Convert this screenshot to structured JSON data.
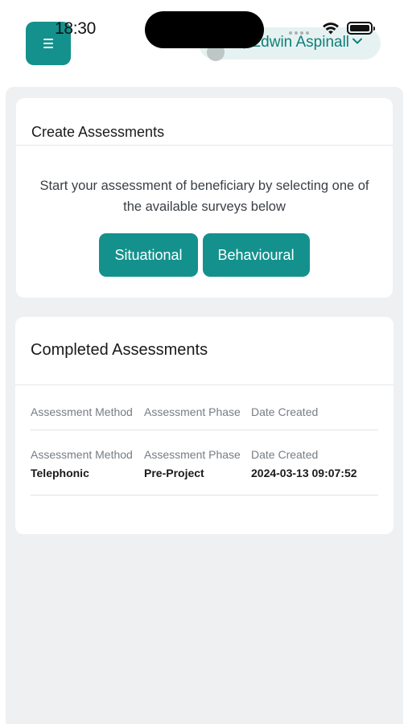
{
  "status_bar": {
    "time": "18:30"
  },
  "header": {
    "menu_label": "≡",
    "user_greeting": "Hi, Edwin Aspinall"
  },
  "create_assessments": {
    "title": "Create Assessments",
    "description": "Start your assessment of beneficiary by selecting one of the available surveys below",
    "buttons": [
      {
        "label": "Situational"
      },
      {
        "label": "Behavioural"
      }
    ]
  },
  "completed_assessments": {
    "title": "Completed Assessments",
    "columns": [
      "Assessment Method",
      "Assessment Phase",
      "Date Created"
    ],
    "rows": [
      {
        "labels": [
          "Assessment Method",
          "Assessment Phase",
          "Date Created"
        ],
        "values": [
          "Telephonic",
          "Pre-Project",
          "2024-03-13 09:07:52"
        ]
      }
    ]
  },
  "colors": {
    "accent": "#14918c",
    "panel_bg": "#eef0f2",
    "pill_bg": "#e6f2f1"
  }
}
